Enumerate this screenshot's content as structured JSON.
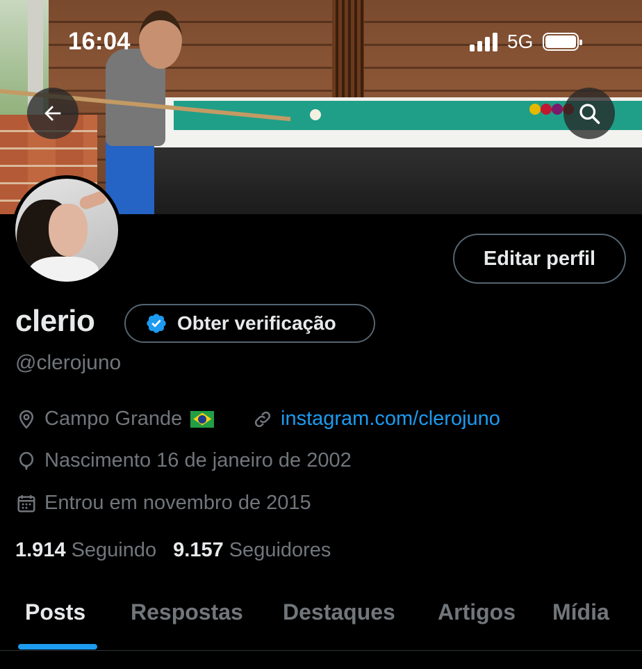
{
  "status_bar": {
    "time": "16:04",
    "network": "5G"
  },
  "header": {
    "back_icon": "arrow-left-icon",
    "search_icon": "search-icon"
  },
  "profile": {
    "edit_button_label": "Editar perfil",
    "display_name": "clerio",
    "verify_button_label": "Obter verificação",
    "handle": "@clerojuno",
    "location": "Campo Grande",
    "link": "instagram.com/clerojuno",
    "birth": "Nascimento 16 de janeiro de 2002",
    "joined": "Entrou em novembro de 2015",
    "following_count": "1.914",
    "following_label": "Seguindo",
    "followers_count": "9.157",
    "followers_label": "Seguidores"
  },
  "tabs": [
    {
      "label": "Posts",
      "active": true
    },
    {
      "label": "Respostas"
    },
    {
      "label": "Destaques"
    },
    {
      "label": "Artigos"
    },
    {
      "label": "Mídia"
    }
  ],
  "colors": {
    "accent": "#1d9bf0",
    "muted": "#71767b",
    "text": "#e7e9ea",
    "border": "#536471"
  }
}
